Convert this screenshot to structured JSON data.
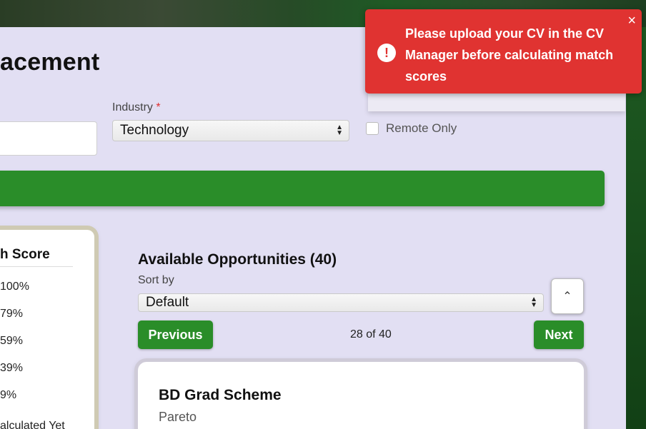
{
  "page": {
    "title": "acement"
  },
  "filters": {
    "industry_label": "Industry",
    "industry_required_mark": "*",
    "industry_value": "Technology",
    "remote_label": "Remote Only"
  },
  "match_filter": {
    "title": "h Score",
    "items": [
      "100%",
      "79%",
      "59%",
      "39%",
      "9%",
      "alculated Yet"
    ]
  },
  "opportunities": {
    "title": "Available Opportunities (40)",
    "sort_label": "Sort by",
    "sort_value": "Default",
    "collapse_icon_glyph": "⌃",
    "prev_label": "Previous",
    "next_label": "Next",
    "counter": "28 of 40",
    "card": {
      "title": "BD Grad Scheme",
      "company": "Pareto"
    }
  },
  "toast": {
    "icon_glyph": "!",
    "message": "Please upload your CV in the CV Manager before calculating match scores",
    "close_glyph": "×"
  },
  "colors": {
    "accent_green": "#2a8d29",
    "panel_bg": "#e2dff3",
    "toast_red": "#e03331"
  }
}
